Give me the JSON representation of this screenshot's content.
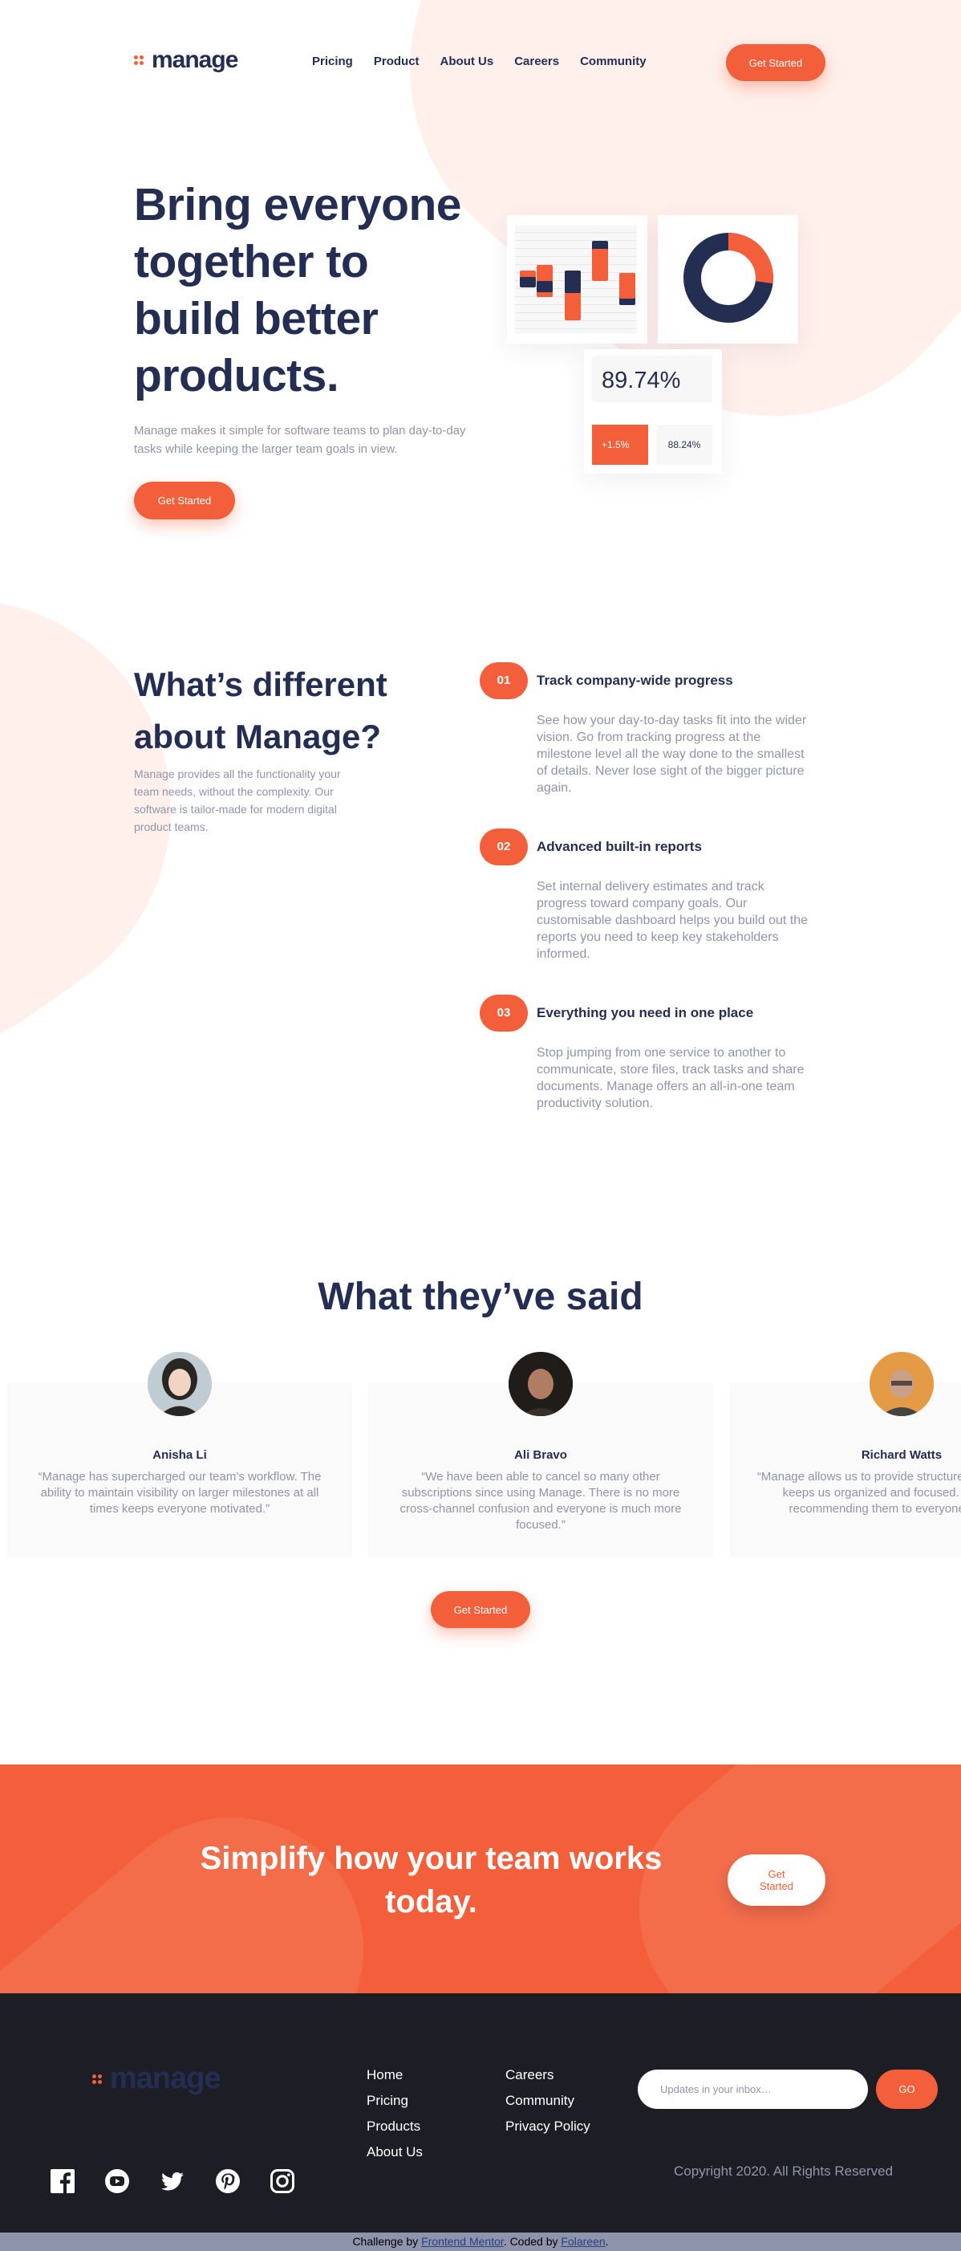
{
  "brand": {
    "name": "manage",
    "accent": "#f25f3a",
    "navy": "#242d52"
  },
  "header": {
    "nav": [
      "Pricing",
      "Product",
      "About Us",
      "Careers",
      "Community"
    ],
    "cta": "Get Started"
  },
  "hero": {
    "title": "Bring everyone together to build better products.",
    "text": "Manage makes it simple for software teams to plan day-to-day tasks while keeping the larger team goals in view.",
    "cta": "Get Started",
    "illustration": {
      "big_stat": "89.74%",
      "change": "+1.5%",
      "secondary_stat": "88.24%",
      "donut_fraction": 0.27
    }
  },
  "different": {
    "title": "What’s different about Manage?",
    "text": "Manage provides all the functionality your team needs, without the complexity. Our software is tailor-made for modern digital product teams.",
    "features": [
      {
        "num": "01",
        "title": "Track company-wide progress",
        "text": "See how your day-to-day tasks fit into the wider vision. Go from tracking progress at the milestone level all the way done to the smallest of details. Never lose sight of the bigger picture again."
      },
      {
        "num": "02",
        "title": "Advanced built-in reports",
        "text": "Set internal delivery estimates and track progress toward company goals. Our customisable dashboard helps you build out the reports you need to keep key stakeholders informed."
      },
      {
        "num": "03",
        "title": "Everything you need in one place",
        "text": "Stop jumping from one service to another to communicate, store files, track tasks and share documents. Manage offers an all-in-one team productivity solution."
      }
    ]
  },
  "testimonials": {
    "title": "What they’ve said",
    "items": [
      {
        "name": "Anisha Li",
        "quote": "“Manage has supercharged our team’s workflow. The ability to maintain visibility on larger milestones at all times keeps everyone motivated.”"
      },
      {
        "name": "Ali Bravo",
        "quote": "“We have been able to cancel so many other subscriptions since using Manage. There is no more cross-channel confusion and everyone is much more focused.”"
      },
      {
        "name": "Richard Watts",
        "quote": "“Manage allows us to provide structure and process. It keeps us organized and focused. I can’t stop recommending them to everyone I talk to!”"
      }
    ],
    "cta": "Get Started"
  },
  "cta_band": {
    "title": "Simplify how your team works today.",
    "button": "Get Started"
  },
  "footer": {
    "col1": [
      "Home",
      "Pricing",
      "Products",
      "About Us"
    ],
    "col2": [
      "Careers",
      "Community",
      "Privacy Policy"
    ],
    "subscribe_placeholder": "Updates in your inbox…",
    "subscribe_button": "GO",
    "copyright": "Copyright 2020. All Rights Reserved",
    "social": [
      "facebook-icon",
      "youtube-icon",
      "twitter-icon",
      "pinterest-icon",
      "instagram-icon"
    ]
  },
  "attribution": {
    "prefix": "Challenge by",
    "link1": "Frontend Mentor",
    "middle": ". Coded by",
    "link2": "Folareen",
    "suffix": "."
  }
}
